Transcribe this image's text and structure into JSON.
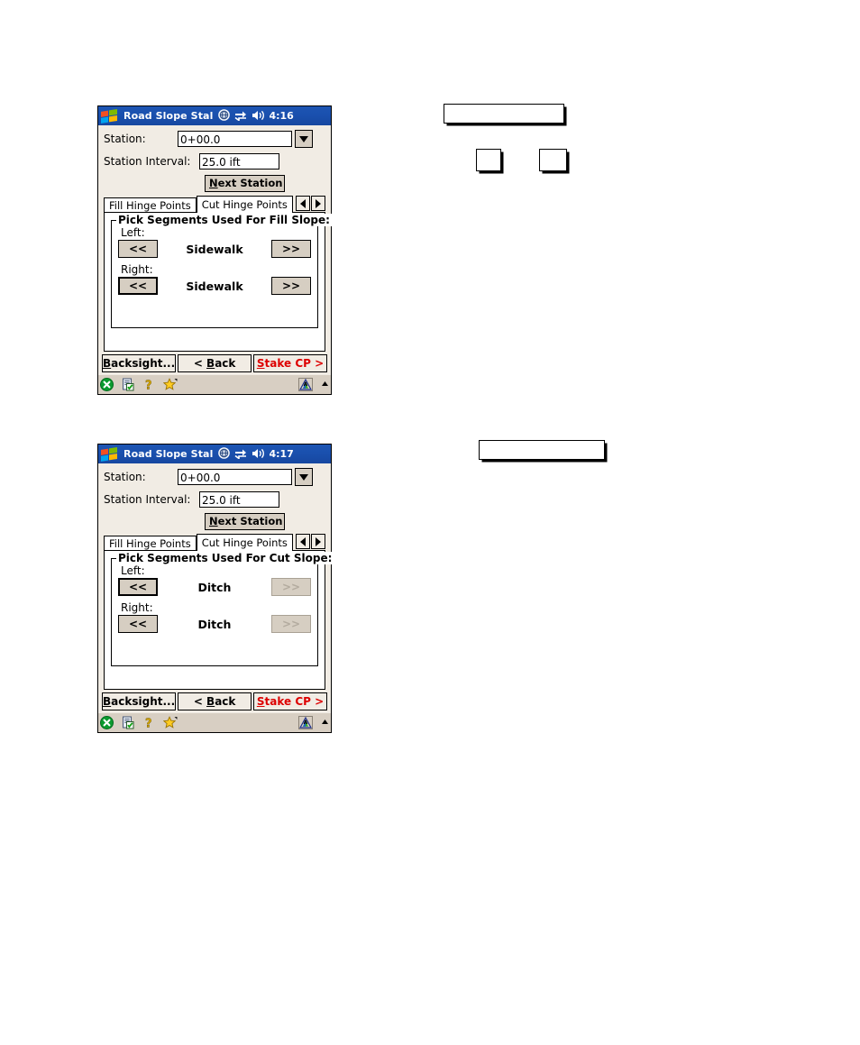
{
  "page": {
    "background": "#ffffff",
    "accent_blue": "#1a50ae",
    "face_color": "#d6cec2",
    "client_color": "#f1ece4",
    "alert_red": "#dd0000"
  },
  "windows": [
    {
      "id": "window-fill-hinge-points",
      "titlebar": {
        "start_icon": "windows-logo-icon",
        "title": "Road Slope Stal",
        "icons": [
          "globe-icon",
          "connectivity-icon",
          "volume-icon"
        ],
        "clock": "4:16"
      },
      "form": {
        "station_label": "Station:",
        "station_value": "0+00.0",
        "station_dropdown_icon": "chevron-down-icon",
        "interval_label": "Station Interval:",
        "interval_value": "25.0 ift",
        "next_station_button": {
          "accel": "N",
          "rest": "ext Station"
        }
      },
      "tabs": {
        "items": [
          {
            "label": "Fill Hinge Points",
            "active": true
          },
          {
            "label": "Cut Hinge Points",
            "active": false
          }
        ],
        "scroll_left_icon": "triangle-left-icon",
        "scroll_right_icon": "triangle-right-icon"
      },
      "group": {
        "title": "Pick Segments Used For Fill Slope:",
        "rows": [
          {
            "side_label": "Left:",
            "prev_label": "<<",
            "segment": "Sidewalk",
            "next_label": ">>",
            "prev_focused": false,
            "next_disabled": false
          },
          {
            "side_label": "Right:",
            "prev_label": "<<",
            "segment": "Sidewalk",
            "next_label": ">>",
            "prev_focused": true,
            "next_disabled": false
          }
        ]
      },
      "commands": [
        {
          "accel": "B",
          "rest": "acksight...",
          "red": false
        },
        {
          "accel": "B",
          "rest": "ack",
          "prefix": "< ",
          "red": false
        },
        {
          "accel": "S",
          "rest": "take CP >",
          "red": true
        }
      ],
      "taskbar": {
        "icons": [
          "close-icon",
          "notes-checklist-icon",
          "help-icon",
          "favorites-star-icon"
        ],
        "right_icons": [
          "survey-triangle-icon",
          "input-panel-arrow-icon"
        ]
      }
    },
    {
      "id": "window-cut-hinge-points",
      "titlebar": {
        "start_icon": "windows-logo-icon",
        "title": "Road Slope Stal",
        "icons": [
          "globe-icon",
          "connectivity-icon",
          "volume-icon"
        ],
        "clock": "4:17"
      },
      "form": {
        "station_label": "Station:",
        "station_value": "0+00.0",
        "station_dropdown_icon": "chevron-down-icon",
        "interval_label": "Station Interval:",
        "interval_value": "25.0 ift",
        "next_station_button": {
          "accel": "N",
          "rest": "ext Station"
        }
      },
      "tabs": {
        "items": [
          {
            "label": "Fill Hinge Points",
            "active": false
          },
          {
            "label": "Cut Hinge Points",
            "active": true
          }
        ],
        "scroll_left_icon": "triangle-left-icon",
        "scroll_right_icon": "triangle-right-icon"
      },
      "group": {
        "title": "Pick Segments Used For Cut Slope:",
        "rows": [
          {
            "side_label": "Left:",
            "prev_label": "<<",
            "segment": "Ditch",
            "next_label": ">>",
            "prev_focused": true,
            "next_disabled": true
          },
          {
            "side_label": "Right:",
            "prev_label": "<<",
            "segment": "Ditch",
            "next_label": ">>",
            "prev_focused": false,
            "next_disabled": true
          }
        ]
      },
      "commands": [
        {
          "accel": "B",
          "rest": "acksight...",
          "red": false
        },
        {
          "accel": "B",
          "rest": "ack",
          "prefix": "< ",
          "red": false
        },
        {
          "accel": "S",
          "rest": "take CP >",
          "red": true
        }
      ],
      "taskbar": {
        "icons": [
          "close-icon",
          "notes-checklist-icon",
          "help-icon",
          "favorites-star-icon"
        ],
        "right_icons": [
          "survey-triangle-icon",
          "input-panel-arrow-icon"
        ]
      }
    }
  ],
  "callouts": [
    {
      "id": "callout-top-wide",
      "text": ""
    },
    {
      "id": "callout-small-left",
      "text": ""
    },
    {
      "id": "callout-small-right",
      "text": ""
    },
    {
      "id": "callout-lower-wide",
      "text": ""
    }
  ]
}
